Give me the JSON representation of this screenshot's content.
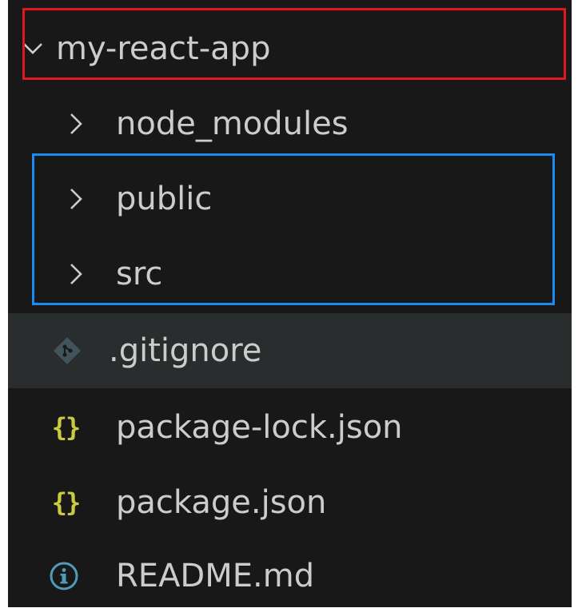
{
  "explorer": {
    "root": {
      "label": "my-react-app",
      "expanded": true,
      "icon": "chevron-down-icon"
    },
    "items": [
      {
        "label": "node_modules",
        "type": "folder",
        "icon": "chevron-right-icon"
      },
      {
        "label": "public",
        "type": "folder",
        "icon": "chevron-right-icon"
      },
      {
        "label": "src",
        "type": "folder",
        "icon": "chevron-right-icon"
      },
      {
        "label": ".gitignore",
        "type": "file",
        "icon": "git-icon",
        "selected": true
      },
      {
        "label": "package-lock.json",
        "type": "file",
        "icon": "json-icon",
        "glyph": "{}"
      },
      {
        "label": "package.json",
        "type": "file",
        "icon": "json-icon",
        "glyph": "{}"
      },
      {
        "label": "README.md",
        "type": "file",
        "icon": "info-icon"
      }
    ]
  },
  "highlights": {
    "red": {
      "color": "#e0191f"
    },
    "blue": {
      "color": "#1a8cf0"
    }
  },
  "colors": {
    "background": "#181818",
    "text": "#cccccc",
    "selected_row": "#2a2d2e",
    "json_icon": "#cbcb41",
    "info_icon": "#519aba",
    "git_icon": "#41535b"
  }
}
